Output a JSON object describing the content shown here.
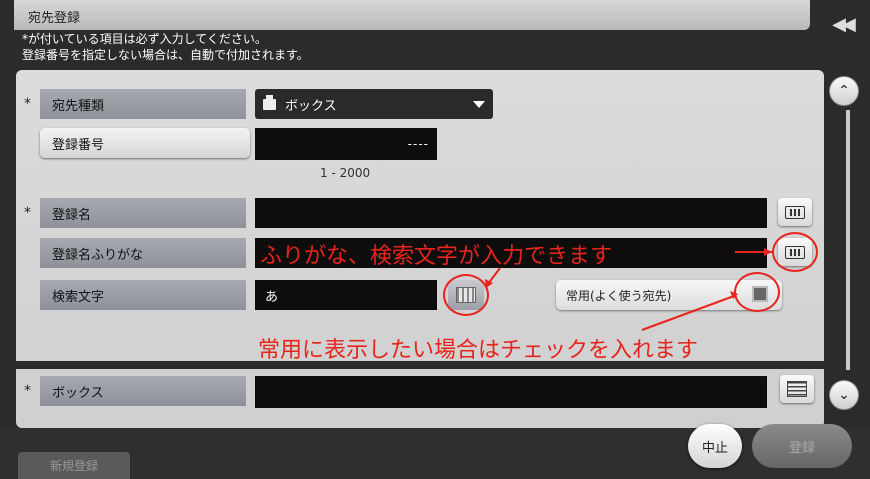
{
  "header": {
    "title": "宛先登録",
    "instruction_line1": "*が付いている項目は必ず入力してください。",
    "instruction_line2": "登録番号を指定しない場合は、自動で付加されます。"
  },
  "form": {
    "required_mark": "*",
    "destination_type": {
      "label": "宛先種類",
      "value": "ボックス",
      "icon": "printer-icon"
    },
    "registration_number": {
      "label": "登録番号",
      "value": "----",
      "range": "1 - 2000"
    },
    "registration_name": {
      "label": "登録名",
      "value": ""
    },
    "name_furigana": {
      "label": "登録名ふりがな",
      "value": ""
    },
    "search_char": {
      "label": "検索文字",
      "value": "あ"
    },
    "frequent": {
      "label": "常用(よく使う宛先)",
      "checked": false
    },
    "box": {
      "label": "ボックス",
      "value": ""
    }
  },
  "buttons": {
    "new_registration": "新規登録",
    "cancel": "中止",
    "register": "登録"
  },
  "annotations": {
    "furigana_note": "ふりがな、検索文字が入力できます",
    "frequent_note": "常用に表示したい場合はチェックを入れます",
    "color": "#e8241c"
  }
}
